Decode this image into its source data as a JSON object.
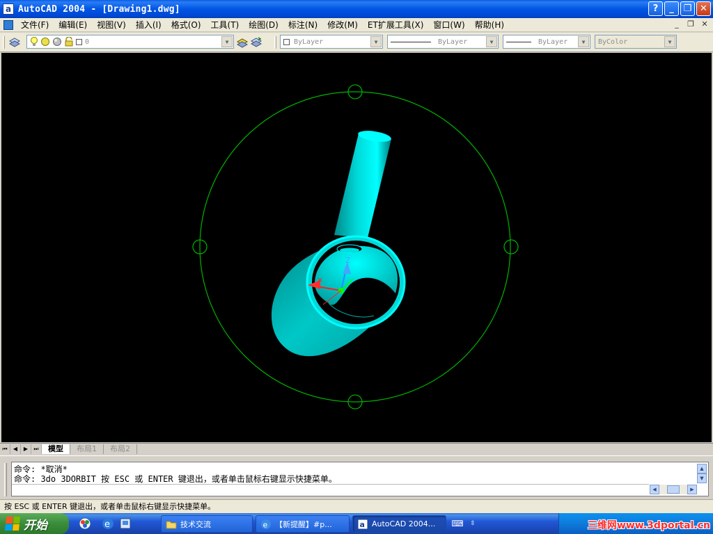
{
  "window": {
    "app_icon": "a",
    "title": "AutoCAD 2004 - [Drawing1.dwg]",
    "help_btn": "?",
    "min_btn": "_",
    "max_btn": "❐",
    "close_btn": "✕"
  },
  "menu": {
    "items": [
      "文件(F)",
      "编辑(E)",
      "视图(V)",
      "插入(I)",
      "格式(O)",
      "工具(T)",
      "绘图(D)",
      "标注(N)",
      "修改(M)",
      "ET扩展工具(X)",
      "窗口(W)",
      "帮助(H)"
    ],
    "doc_min": "_",
    "doc_restore": "❐",
    "doc_close": "✕"
  },
  "toolbar": {
    "layer_value": "0",
    "color_value": "ByLayer",
    "linetype_value": "ByLayer",
    "lineweight_value": "ByLayer",
    "plotstyle_value": "ByColor"
  },
  "colors": {
    "model_cyan": "#00ffff",
    "orbit_green": "#00b400",
    "axis_x": "#ff2020",
    "axis_y": "#00ff00",
    "axis_z": "#2090ff"
  },
  "icons": {
    "layer_manager": "layers-icon",
    "bulb": "bulb-icon",
    "sun": "sun-icon",
    "lock": "lock-icon",
    "make_current": "make-current-icon",
    "layer_previous": "layer-previous-icon"
  },
  "viewport": {
    "ucs_axis_label": "Z"
  },
  "tabs": {
    "nav": [
      "⏮",
      "◀",
      "▶",
      "⏭"
    ],
    "items": [
      "模型",
      "布局1",
      "布局2"
    ],
    "active": "模型"
  },
  "command": {
    "lines": [
      "命令: *取消*",
      "命令: 3do 3DORBIT 按 ESC 或 ENTER 键退出，或者单击鼠标右键显示快捷菜单。"
    ],
    "input": ""
  },
  "status": {
    "text": "按 ESC 或 ENTER 键退出，或者单击鼠标右键显示快捷菜单。"
  },
  "taskbar": {
    "start_label": "开始",
    "tasks": [
      "技术交流",
      "【新提醒】#p...",
      "AutoCAD 2004..."
    ],
    "active_task": "AutoCAD 2004...",
    "tray_watermark": "三维网www.3dportal.cn"
  }
}
